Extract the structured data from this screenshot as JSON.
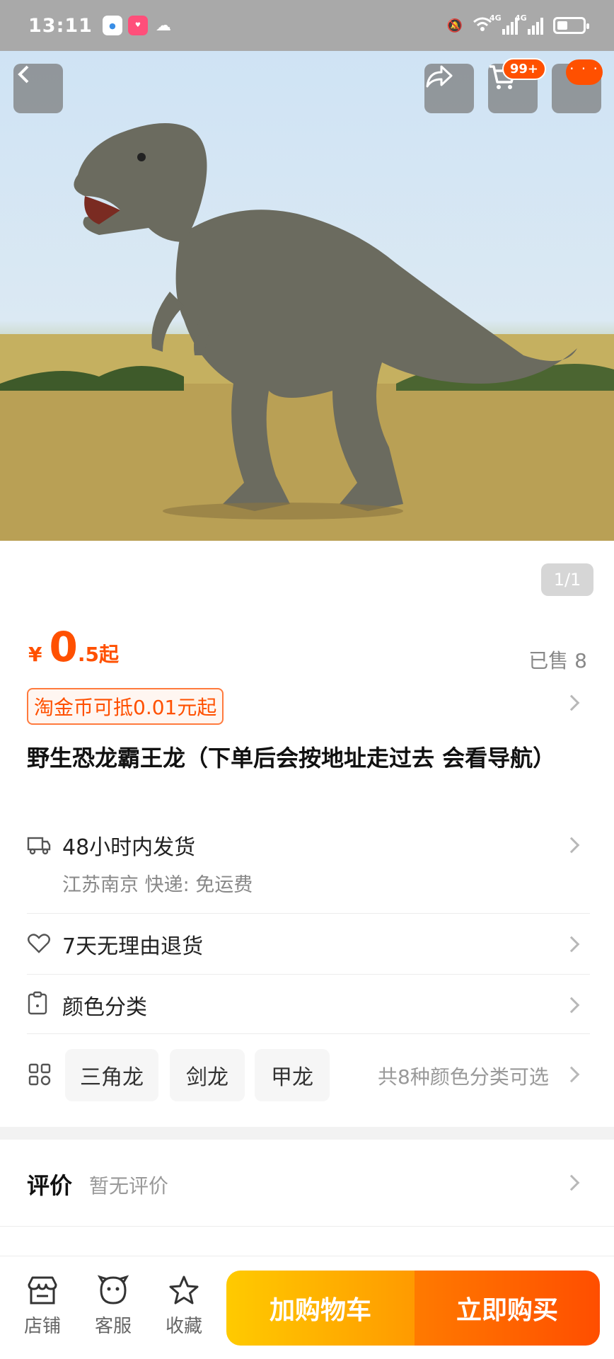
{
  "status_bar": {
    "time": "13:11",
    "app_icons": [
      "browser-icon",
      "app-icon",
      "wechat-icon"
    ],
    "network": [
      "4G",
      "4G"
    ]
  },
  "header": {
    "cart_badge": "99+",
    "more_badge": "· · ·"
  },
  "gallery": {
    "counter": "1/1"
  },
  "price": {
    "currency": "¥",
    "integer": "0",
    "decimal": ".5",
    "suffix": "起",
    "sold": "已售 8"
  },
  "coupon": "淘金币可抵0.01元起",
  "title": "野生恐龙霸王龙（下单后会按地址走过去 会看导航）",
  "shipping": {
    "label": "48小时内发货",
    "detail": "江苏南京  快递: 免运费"
  },
  "returns": {
    "label": "7天无理由退货"
  },
  "variants": {
    "label": "颜色分类",
    "options": [
      "三角龙",
      "剑龙",
      "甲龙"
    ],
    "more": "共8种颜色分类可选"
  },
  "reviews": {
    "title": "评价",
    "empty": "暂无评价"
  },
  "bottom_bar": {
    "tabs": [
      "店铺",
      "客服",
      "收藏"
    ],
    "add_to_cart": "加购物车",
    "buy_now": "立即购买"
  },
  "colors": {
    "accent": "#ff5000",
    "cart_button": "#ffb000",
    "buy_button": "#ff5a00"
  }
}
